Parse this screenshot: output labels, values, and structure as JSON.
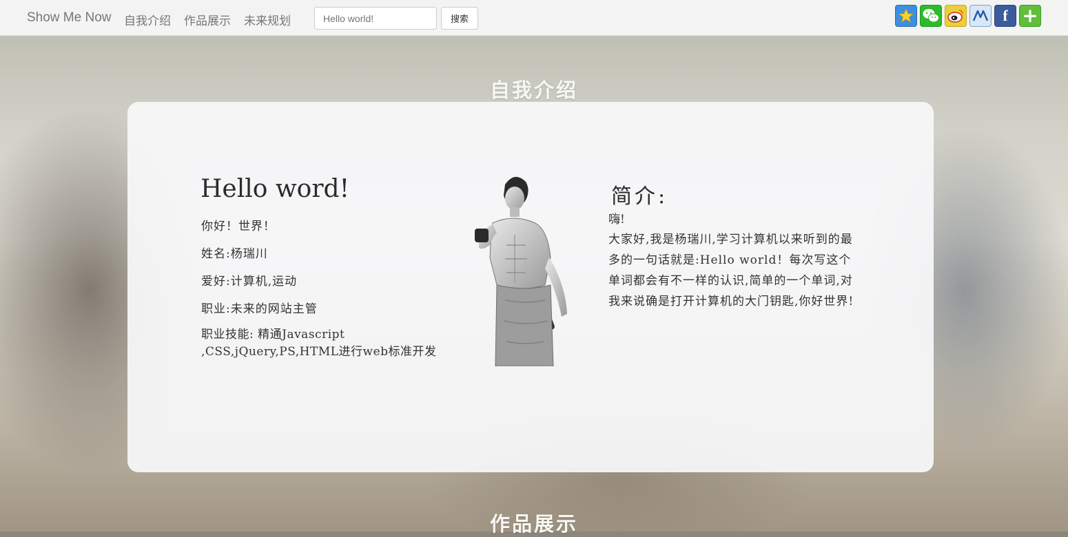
{
  "nav": {
    "brand": "Show Me Now",
    "links": [
      "自我介绍",
      "作品展示",
      "未来规划"
    ],
    "search_placeholder": "Hello world!",
    "search_button": "搜索",
    "share_icons": [
      "qzone-icon",
      "wechat-icon",
      "weibo-icon",
      "renren-icon",
      "facebook-icon",
      "more-share-icon"
    ]
  },
  "sections": {
    "intro_title": "自我介绍",
    "works_title": "作品展示"
  },
  "profile": {
    "heading": "Hello word!",
    "lines": [
      "你好！世界！",
      "姓名:杨瑞川",
      "爱好:计算机,运动",
      "职业:未来的网站主管"
    ],
    "skills": "职业技能: 精通Javascript ,CSS,jQuery,PS,HTML进行web标准开发"
  },
  "bio": {
    "title": "简介:",
    "greeting": "嗨!",
    "body": "大家好,我是杨瑞川,学习计算机以来听到的最多的一句话就是:Hello world！每次写这个单词都会有不一样的认识,简单的一个单词,对我来说确是打开计算机的大门钥匙,你好世界!"
  },
  "colors": {
    "navbar_bg": "#f8f8f8",
    "nav_text": "#777777",
    "card_bg": "#f8f8fa",
    "section_title": "#f7f7f4"
  }
}
